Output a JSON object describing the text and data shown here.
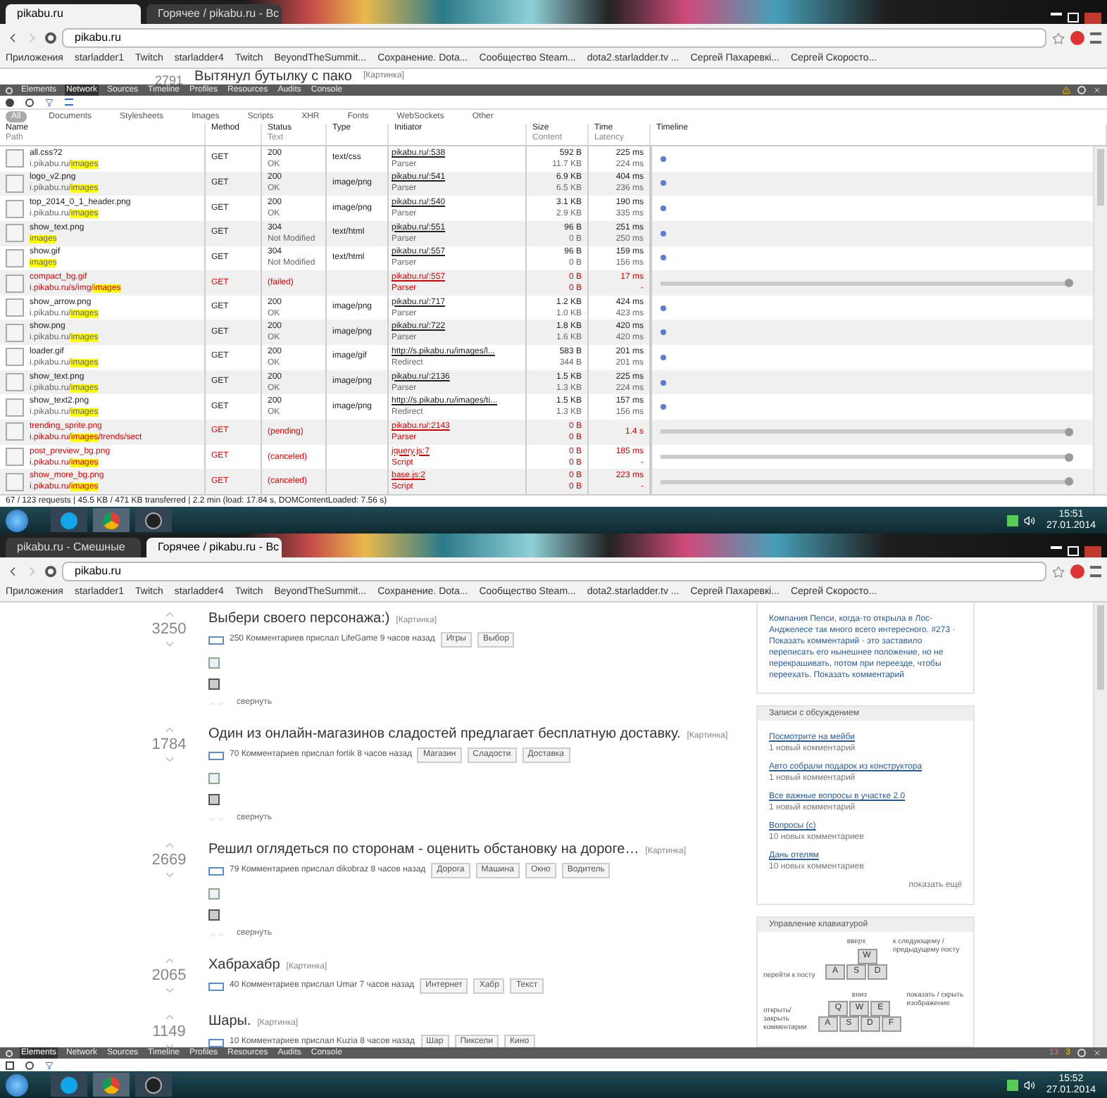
{
  "top_window": {
    "tabs": [
      {
        "label": "pikabu.ru",
        "selected": true
      },
      {
        "label": "Горячее / pikabu.ru - Вс",
        "selected": false
      }
    ],
    "address": "pikabu.ru",
    "bookmarks": [
      "Приложения",
      "starladder1",
      "Twitch",
      "starladder4",
      "Twitch",
      "BeyondTheSummit...",
      "Сохранение. Dota...",
      "Сообщество Steam...",
      "dota2.starladder.tv ...",
      "Сергей Пахаревкi...",
      "Сергей Скоросто..."
    ],
    "post": {
      "score": "2791",
      "title": "Вытянул бутылку с пако",
      "tag": "[Картинка]"
    },
    "devtools": {
      "tabs": [
        {
          "label": "Elements",
          "selected": false
        },
        {
          "label": "Network",
          "selected": true
        },
        {
          "label": "Sources",
          "selected": false
        },
        {
          "label": "Timeline",
          "selected": false
        },
        {
          "label": "Profiles",
          "selected": false
        },
        {
          "label": "Resources",
          "selected": false
        },
        {
          "label": "Audits",
          "selected": false
        },
        {
          "label": "Console",
          "selected": false
        }
      ],
      "filters": [
        {
          "label": "All",
          "selected": true
        },
        {
          "label": "Documents",
          "selected": false
        },
        {
          "label": "Stylesheets",
          "selected": false
        },
        {
          "label": "Images",
          "selected": false
        },
        {
          "label": "Scripts",
          "selected": false
        },
        {
          "label": "XHR",
          "selected": false
        },
        {
          "label": "Fonts",
          "selected": false
        },
        {
          "label": "WebSockets",
          "selected": false
        },
        {
          "label": "Other",
          "selected": false
        }
      ],
      "columns": [
        {
          "title": "Name",
          "sub": "Path"
        },
        {
          "title": "Method"
        },
        {
          "title": "Status",
          "sub": "Text"
        },
        {
          "title": "Type"
        },
        {
          "title": "Initiator"
        },
        {
          "title": "Size",
          "sub": "Content"
        },
        {
          "title": "Time",
          "sub": "Latency"
        },
        {
          "title": "Timeline"
        }
      ],
      "rows": [
        {
          "name": "all.css?2",
          "path": "i.pikabu.ru/",
          "match": "images",
          "method": "GET",
          "status": "200",
          "status_text": "OK",
          "type": "text/css",
          "initiator": "pikabu.ru/:538",
          "initiator_type": "Parser",
          "size": "592 B",
          "content": "11.7 KB",
          "time": "225 ms",
          "latency": "224 ms",
          "failed": false
        },
        {
          "name": "logo_v2.png",
          "path": "i.pikabu.ru/",
          "match": "images",
          "method": "GET",
          "status": "200",
          "status_text": "OK",
          "type": "image/png",
          "initiator": "pikabu.ru/:541",
          "initiator_type": "Parser",
          "size": "6.9 KB",
          "content": "6.5 KB",
          "time": "404 ms",
          "latency": "236 ms",
          "failed": false
        },
        {
          "name": "top_2014_0_1_header.png",
          "path": "i.pikabu.ru/",
          "match": "images",
          "method": "GET",
          "status": "200",
          "status_text": "OK",
          "type": "image/png",
          "initiator": "pikabu.ru/:540",
          "initiator_type": "Parser",
          "size": "3.1 KB",
          "content": "2.9 KB",
          "time": "190 ms",
          "latency": "335 ms",
          "failed": false
        },
        {
          "name": "show_text.png",
          "path": "",
          "match": "images",
          "method": "GET",
          "status": "304",
          "status_text": "Not Modified",
          "type": "text/html",
          "initiator": "pikabu.ru/:551",
          "initiator_type": "Parser",
          "size": "96 B",
          "content": "0 B",
          "time": "251 ms",
          "latency": "250 ms",
          "failed": false
        },
        {
          "name": "show.gif",
          "path": "",
          "match": "images",
          "method": "GET",
          "status": "304",
          "status_text": "Not Modified",
          "type": "text/html",
          "initiator": "pikabu.ru/:557",
          "initiator_type": "Parser",
          "size": "96 B",
          "content": "0 B",
          "time": "159 ms",
          "latency": "156 ms",
          "failed": false
        },
        {
          "name": "compact_bg.gif",
          "path": "i.pikabu.ru/s/img/",
          "match": "images",
          "method": "GET",
          "status": "(failed)",
          "status_text": "",
          "type": "",
          "initiator": "pikabu.ru/:557",
          "initiator_type": "Parser",
          "size": "0 B",
          "content": "0 B",
          "time": "17 ms",
          "latency": "-",
          "failed": true
        },
        {
          "name": "show_arrow.png",
          "path": "i.pikabu.ru/",
          "match": "images",
          "method": "GET",
          "status": "200",
          "status_text": "OK",
          "type": "image/png",
          "initiator": "pikabu.ru/:717",
          "initiator_type": "Parser",
          "size": "1.2 KB",
          "content": "1.0 KB",
          "time": "424 ms",
          "latency": "423 ms",
          "failed": false
        },
        {
          "name": "show.png",
          "path": "i.pikabu.ru/",
          "match": "images",
          "method": "GET",
          "status": "200",
          "status_text": "OK",
          "type": "image/png",
          "initiator": "pikabu.ru/:722",
          "initiator_type": "Parser",
          "size": "1.8 KB",
          "content": "1.6 KB",
          "time": "420 ms",
          "latency": "420 ms",
          "failed": false
        },
        {
          "name": "loader.gif",
          "path": "i.pikabu.ru/",
          "match": "images",
          "method": "GET",
          "status": "200",
          "status_text": "OK",
          "type": "image/gif",
          "initiator": "http://s.pikabu.ru/images/l...",
          "initiator_type": "Redirect",
          "size": "583 B",
          "content": "344 B",
          "time": "201 ms",
          "latency": "201 ms",
          "failed": false
        },
        {
          "name": "show_text.png",
          "path": "i.pikabu.ru/",
          "match": "images",
          "method": "GET",
          "status": "200",
          "status_text": "OK",
          "type": "image/png",
          "initiator": "pikabu.ru/:2136",
          "initiator_type": "Parser",
          "size": "1.5 KB",
          "content": "1.3 KB",
          "time": "225 ms",
          "latency": "224 ms",
          "failed": false
        },
        {
          "name": "show_text2.png",
          "path": "i.pikabu.ru/",
          "match": "images",
          "method": "GET",
          "status": "200",
          "status_text": "OK",
          "type": "image/png",
          "initiator": "http://s.pikabu.ru/images/ti...",
          "initiator_type": "Redirect",
          "size": "1.5 KB",
          "content": "1.3 KB",
          "time": "157 ms",
          "latency": "156 ms",
          "failed": false
        },
        {
          "name": "trending_sprite.png",
          "path": "i.pikabu.ru/",
          "match": "images",
          "suffix": "/trends/sect",
          "method": "GET",
          "status": "(pending)",
          "status_text": "",
          "type": "",
          "initiator": "pikabu.ru/:2143",
          "initiator_type": "Parser",
          "size": "0 B",
          "content": "0 B",
          "time": "1.4 s",
          "latency": "",
          "failed": true
        },
        {
          "name": "post_preview_bg.png",
          "path": "i.pikabu.ru/",
          "match": "images",
          "method": "GET",
          "status": "(canceled)",
          "status_text": "",
          "type": "",
          "initiator": "jquery.js:7",
          "initiator_type": "Script",
          "size": "0 B",
          "content": "0 B",
          "time": "185 ms",
          "latency": "-",
          "failed": true
        },
        {
          "name": "show_more_bg.png",
          "path": "i.pikabu.ru/",
          "match": "images",
          "method": "GET",
          "status": "(canceled)",
          "status_text": "",
          "type": "",
          "initiator": "base.js:2",
          "initiator_type": "Script",
          "size": "0 B",
          "content": "0 B",
          "time": "223 ms",
          "latency": "-",
          "failed": true
        }
      ],
      "status": "67 / 123 requests | 45.5 KB / 471 KB transferred | 2.2 min (load: 17.84 s, DOMContentLoaded: 7.56 s)"
    },
    "clock": {
      "time": "15:51",
      "date": "27.01.2014"
    }
  },
  "bottom_window": {
    "tabs": [
      {
        "label": "pikabu.ru - Смешные",
        "selected": false
      },
      {
        "label": "Горячее / pikabu.ru - Вс",
        "selected": true
      }
    ],
    "address": "pikabu.ru",
    "bookmarks": [
      "Приложения",
      "starladder1",
      "Twitch",
      "starladder4",
      "Twitch",
      "BeyondTheSummit...",
      "Сохранение. Dota...",
      "Сообщество Steam...",
      "dota2.starladder.tv ...",
      "Сергей Пахаревкi...",
      "Сергей Скоросто..."
    ],
    "posts": [
      {
        "score": "3250",
        "title": "Выбери своего персонажа:)",
        "tag": "[Картинка]",
        "meta": "250 Комментариев прислал LifeGame 9 часов назад",
        "labels": [
          "Игры",
          "Выбор"
        ],
        "collapse": "свернуть"
      },
      {
        "score": "1784",
        "title": "Один из онлайн-магазинов сладостей предлагает бесплатную доставку.",
        "tag": "[Картинка]",
        "meta": "70 Комментариев прислал fortik 8 часов назад",
        "labels": [
          "Магазин",
          "Сладости",
          "Доставка"
        ],
        "collapse": "свернуть"
      },
      {
        "score": "2669",
        "title": "Решил оглядеться по сторонам - оценить обстановку на дороге…",
        "tag": "[Картинка]",
        "meta": "79 Комментариев прислал dikobraz 8 часов назад",
        "labels": [
          "Дорога",
          "Машина",
          "Окно",
          "Водитель"
        ],
        "collapse": "свернуть"
      },
      {
        "score": "2065",
        "title": "Хабрахабр",
        "tag": "[Картинка]",
        "meta": "40 Комментариев прислал Umar 7 часов назад",
        "labels": [
          "Интернет",
          "Хабр",
          "Текст"
        ]
      },
      {
        "score": "1149",
        "title": "Шары.",
        "tag": "[Картинка]",
        "meta": "10 Комментариев прислал Kuzia 8 часов назад",
        "labels": [
          "Шар",
          "Пиксели",
          "Кино"
        ]
      }
    ],
    "comment_box": "Компания Пепси, когда-то открыла в Лос-Анджелесе так много всего интересного. #273 · Показать комментарий · это заставило переписать его нынешнее положение, но не перекрашивать, потом при переезде, чтобы переехать. Показать комментарий",
    "discussed": {
      "title": "Записи с обсуждением",
      "items": [
        {
          "link": "Посмотрите на мейби",
          "note": "1 новый комментарий"
        },
        {
          "link": "Авто собрали подарок из конструктора",
          "note": "1 новый комментарий"
        },
        {
          "link": "Все важные вопросы в участке 2.0",
          "note": "1 новый комментарий"
        },
        {
          "link": "Вопросы (с)",
          "note": "10 новых комментариев"
        },
        {
          "link": "Дань отелям",
          "note": "10 новых комментариев"
        }
      ],
      "more": "показать ещё"
    },
    "keyboard": {
      "title": "Управление клавиатурой",
      "groups": [
        {
          "label": "перейти к посту",
          "top_label": "вверх",
          "side_label": "к следующему / предыдущему посту",
          "rows": [
            [
              "",
              "W"
            ],
            [
              "A",
              "S",
              "D"
            ]
          ]
        },
        {
          "label": "открыть/закрыть комментарии",
          "top_label": "вниз",
          "side_label": "показать / скрыть изображение",
          "rows": [
            [
              "Q",
              "W",
              "E"
            ],
            [
              "A",
              "S",
              "D",
              "F"
            ]
          ]
        }
      ]
    },
    "devtools": {
      "tabs": [
        {
          "label": "Elements",
          "selected": true
        },
        {
          "label": "Network",
          "selected": false
        },
        {
          "label": "Sources",
          "selected": false
        },
        {
          "label": "Timeline",
          "selected": false
        },
        {
          "label": "Profiles",
          "selected": false
        },
        {
          "label": "Resources",
          "selected": false
        },
        {
          "label": "Audits",
          "selected": false
        },
        {
          "label": "Console",
          "selected": false
        }
      ],
      "errors": "13",
      "warnings": "3"
    },
    "clock": {
      "time": "15:52",
      "date": "27.01.2014"
    }
  }
}
